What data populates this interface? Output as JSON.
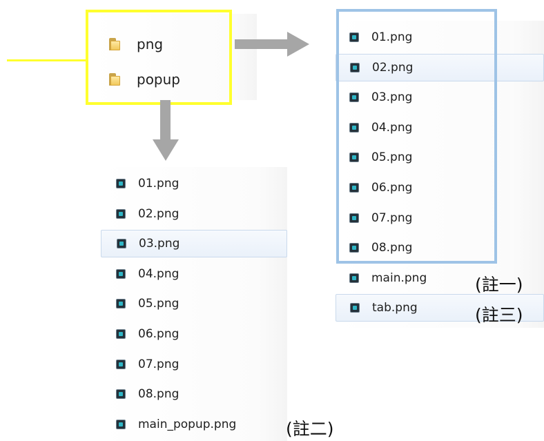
{
  "colors": {
    "yellow_highlight": "#ffff2e",
    "blue_highlight": "#9ec3e6",
    "blue_line": "#6b9fd4",
    "arrow_gray": "#a6a6a6"
  },
  "folders": [
    {
      "icon": "folder-icon",
      "name": "png"
    },
    {
      "icon": "folder-icon",
      "name": "popup"
    }
  ],
  "png_folder": {
    "files": [
      {
        "name": "01.png",
        "selected": false
      },
      {
        "name": "02.png",
        "selected": true
      },
      {
        "name": "03.png",
        "selected": false
      },
      {
        "name": "04.png",
        "selected": false
      },
      {
        "name": "05.png",
        "selected": false
      },
      {
        "name": "06.png",
        "selected": false
      },
      {
        "name": "07.png",
        "selected": false
      },
      {
        "name": "08.png",
        "selected": false
      },
      {
        "name": "main.png",
        "selected": false
      },
      {
        "name": "tab.png",
        "selected": true
      }
    ],
    "notes": {
      "main": "(註一)",
      "tab": "(註三)"
    }
  },
  "popup_folder": {
    "files": [
      {
        "name": "01.png",
        "selected": false
      },
      {
        "name": "02.png",
        "selected": false
      },
      {
        "name": "03.png",
        "selected": true
      },
      {
        "name": "04.png",
        "selected": false
      },
      {
        "name": "05.png",
        "selected": false
      },
      {
        "name": "06.png",
        "selected": false
      },
      {
        "name": "07.png",
        "selected": false
      },
      {
        "name": "08.png",
        "selected": false
      },
      {
        "name": "main_popup.png",
        "selected": false
      }
    ],
    "notes": {
      "main_popup": "(註二)"
    }
  }
}
